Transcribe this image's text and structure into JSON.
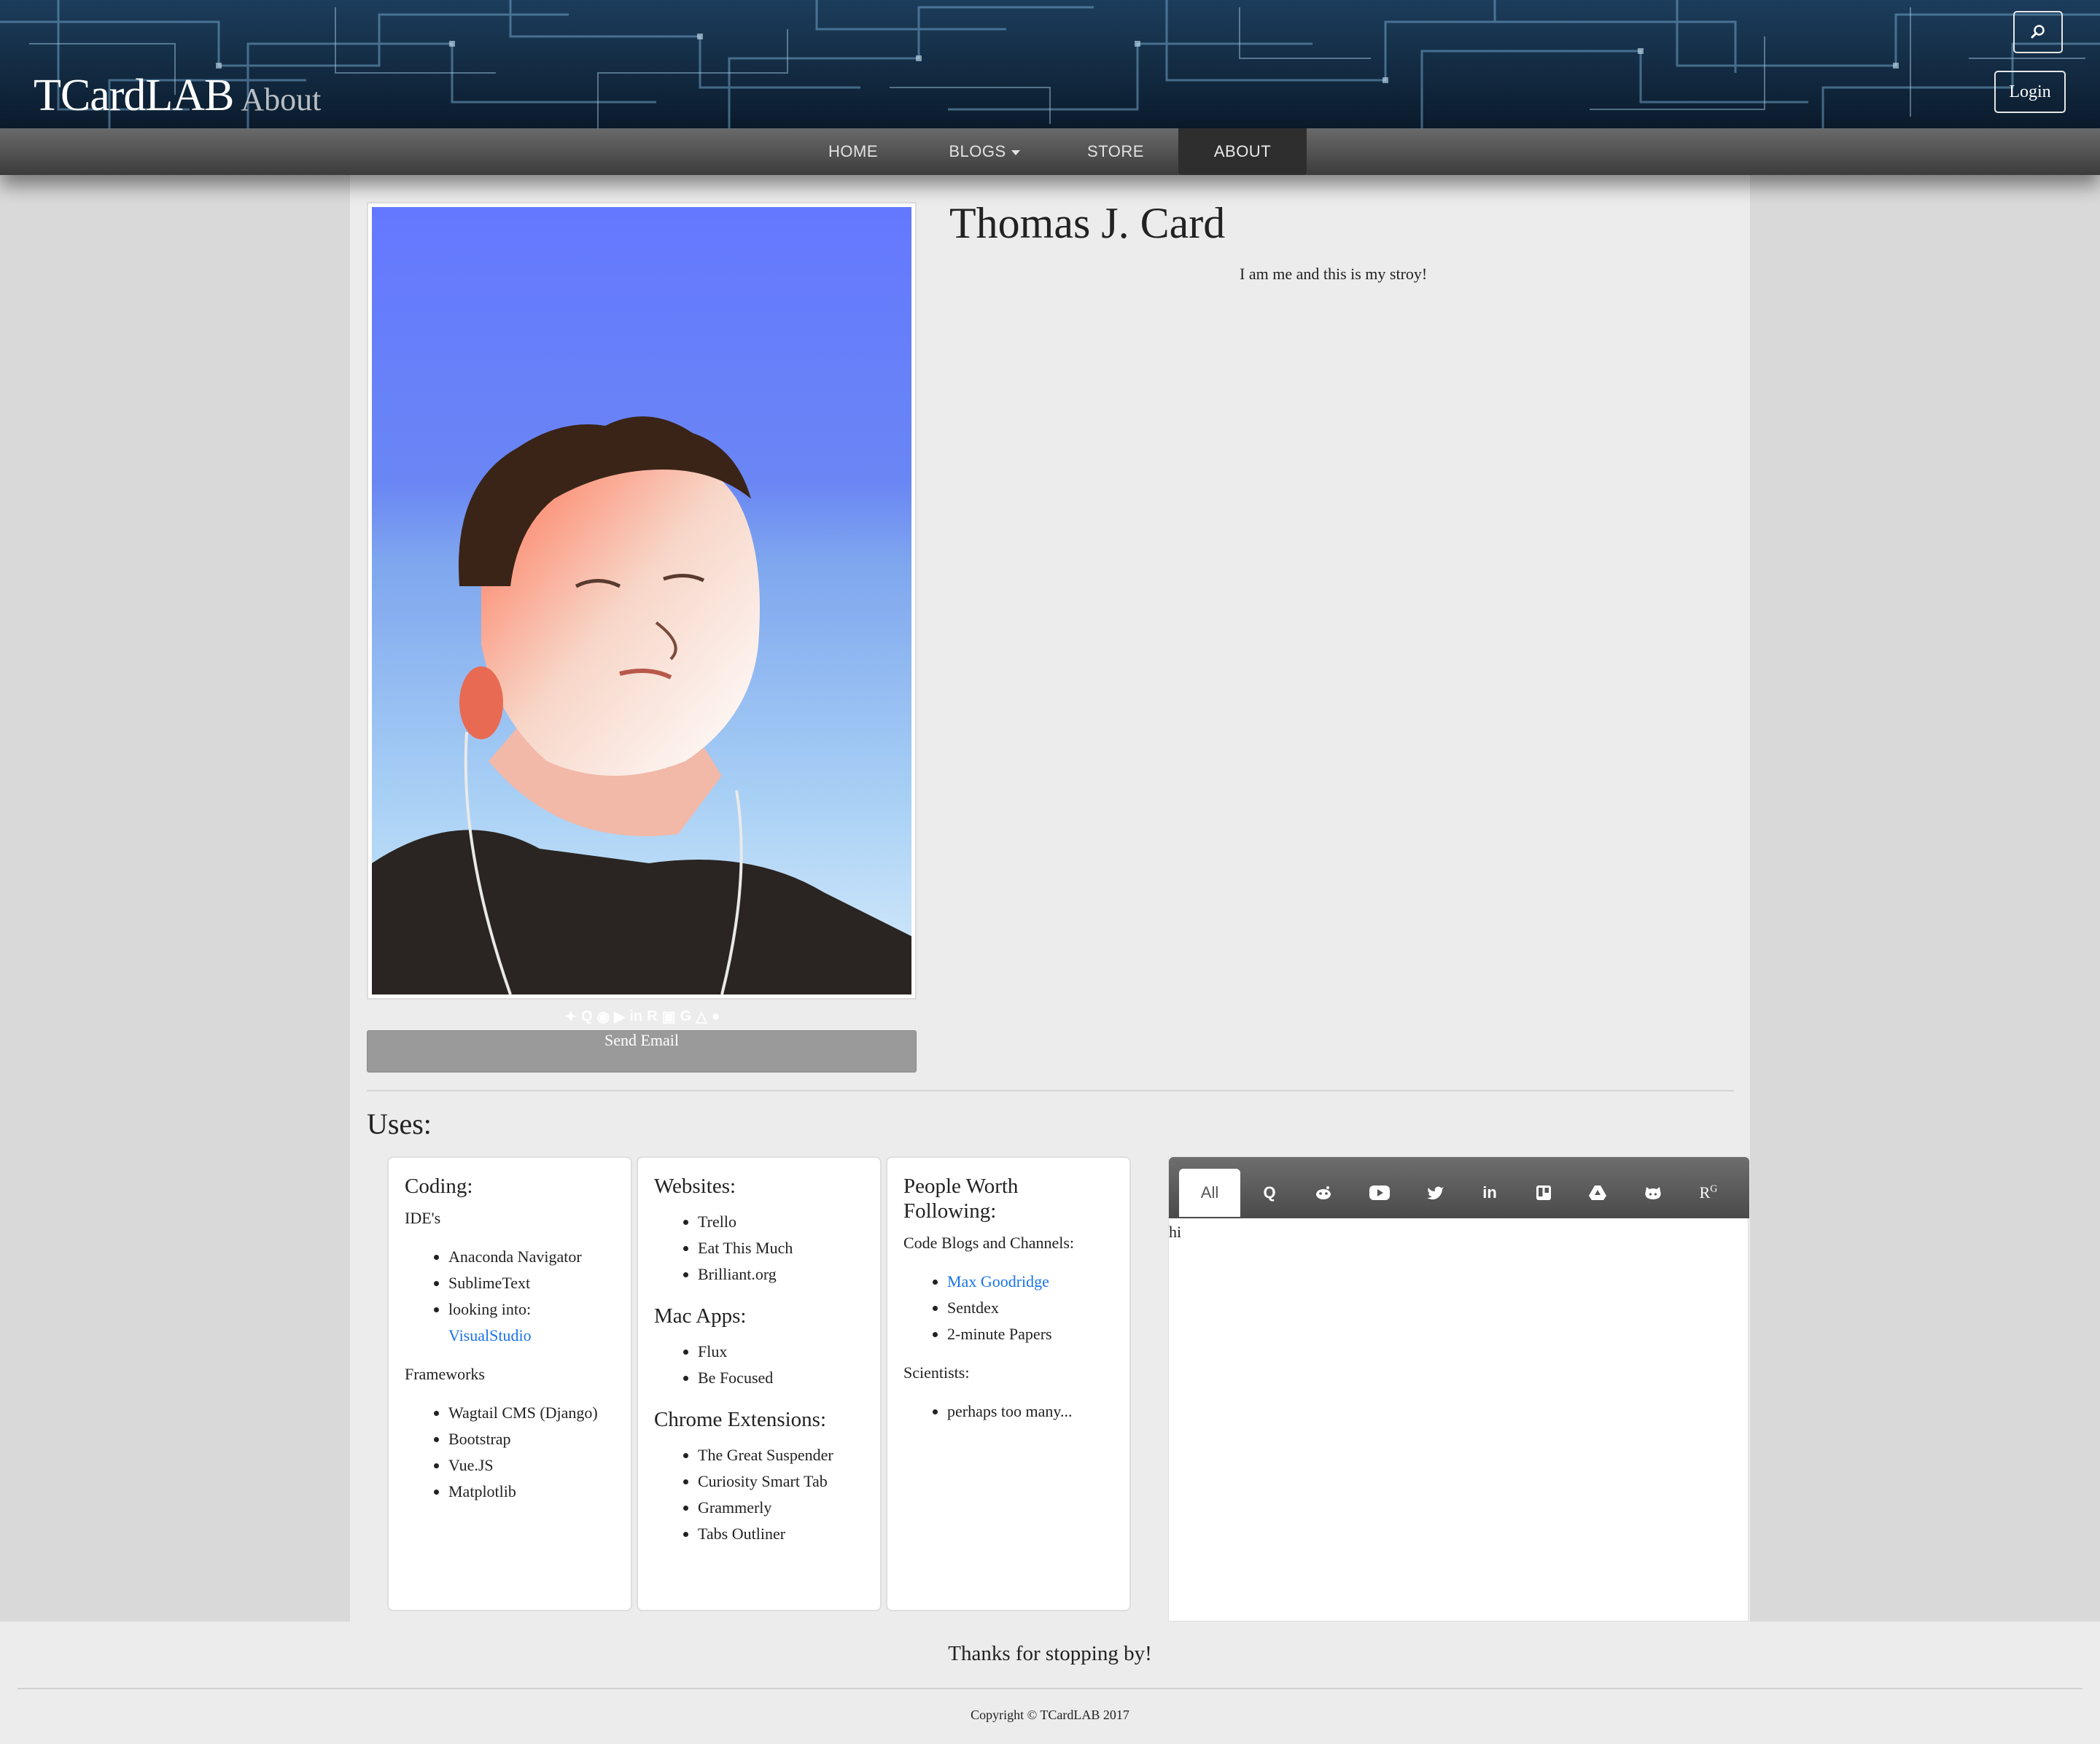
{
  "header": {
    "brand": "TCardLAB",
    "section": "About",
    "login_label": "Login"
  },
  "nav": {
    "items": [
      {
        "label": "HOME"
      },
      {
        "label": "BLOGS"
      },
      {
        "label": "STORE"
      },
      {
        "label": "ABOUT",
        "active": true
      }
    ]
  },
  "profile": {
    "name": "Thomas J. Card",
    "tagline": "I am me and this is my stroy!",
    "send_email_label": "Send Email",
    "social_icons": [
      "twitter-icon",
      "quora-icon",
      "reddit-icon",
      "youtube-icon",
      "linkedin-icon",
      "researchgate-icon",
      "trello-icon",
      "google-icon",
      "google-drive-icon",
      "github-icon"
    ]
  },
  "uses": {
    "title": "Uses:",
    "coding": {
      "title": "Coding:",
      "ide_label": "IDE's",
      "ides": [
        "Anaconda Navigator",
        "SublimeText"
      ],
      "looking_prefix": "looking into: ",
      "looking_link": "VisualStudio",
      "frameworks_label": "Frameworks",
      "frameworks": [
        "Wagtail CMS (Django)",
        "Bootstrap",
        "Vue.JS",
        "Matplotlib"
      ]
    },
    "websites": {
      "title": "Websites:",
      "sites": [
        "Trello",
        "Eat This Much",
        "Brilliant.org"
      ],
      "mac_title": "Mac Apps:",
      "mac_apps": [
        "Flux",
        "Be Focused"
      ],
      "chrome_title": "Chrome Extensions:",
      "chrome_exts": [
        "The Great Suspender",
        "Curiosity Smart Tab",
        "Grammerly",
        "Tabs Outliner"
      ]
    },
    "people": {
      "title": "People Worth Following:",
      "blogs_label": "Code Blogs and Channels:",
      "blog_link": "Max Goodridge",
      "blogs": [
        "Sentdex",
        "2-minute Papers"
      ],
      "scientists_label": "Scientists:",
      "scientists": [
        "perhaps too many..."
      ]
    }
  },
  "tabs": {
    "all_label": "All",
    "icons": [
      "quora-icon",
      "reddit-icon",
      "youtube-icon",
      "twitter-icon",
      "linkedin-icon",
      "trello-icon",
      "google-drive-icon",
      "github-icon",
      "researchgate-icon"
    ],
    "content": "hi"
  },
  "footer": {
    "thanks": "Thanks for stopping by!",
    "copyright": "Copyright © TCardLAB 2017"
  },
  "colors": {
    "header_bg": "#0d2236",
    "circuit": "#6fa3c8",
    "link": "#1a73e8",
    "send_button": "#9a9a9a"
  }
}
